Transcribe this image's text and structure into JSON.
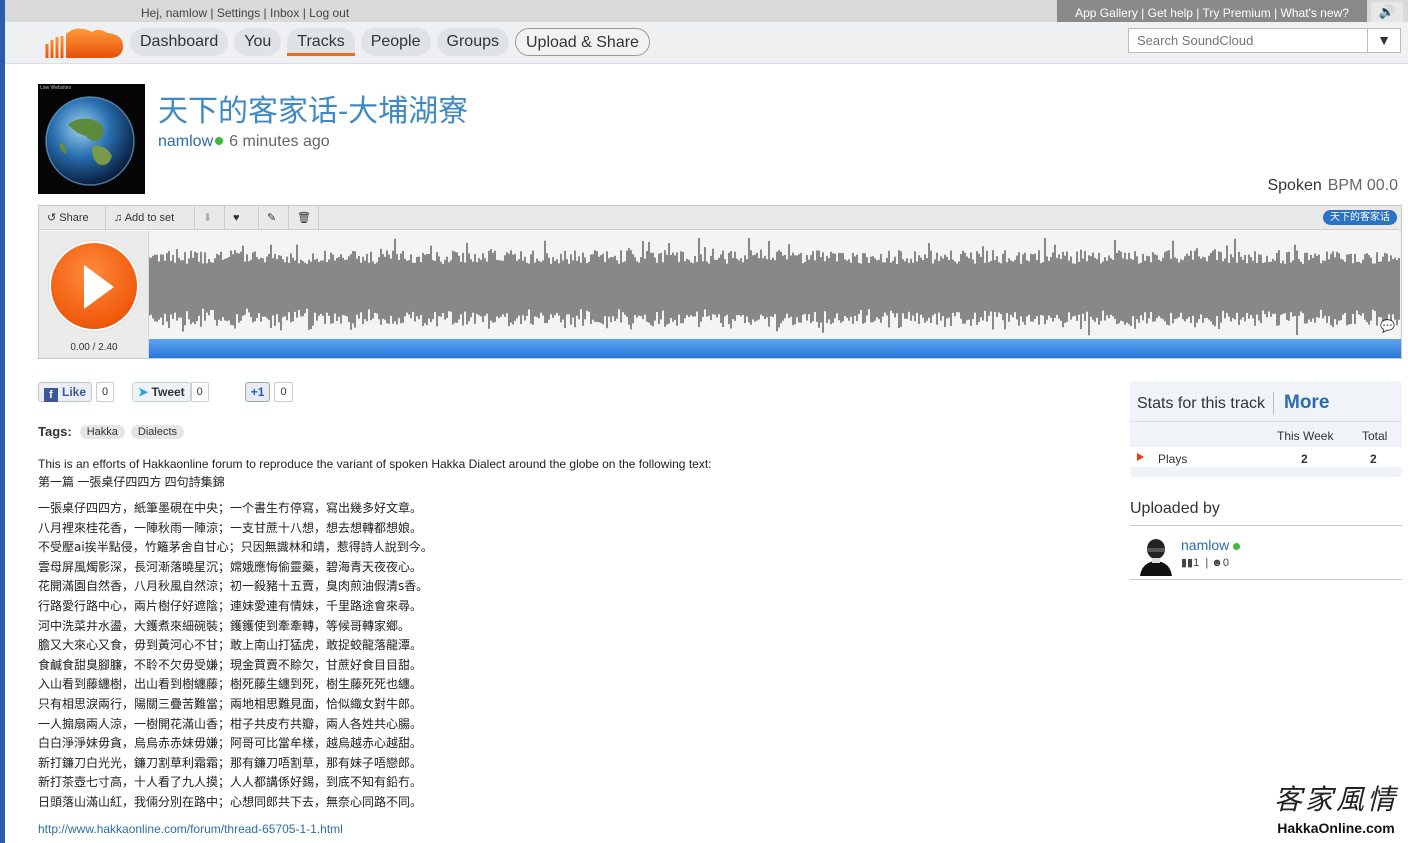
{
  "topbar": {
    "greeting": "Hej,",
    "username": "namlow",
    "links": [
      "Settings",
      "Inbox",
      "Log out"
    ],
    "app_links": "App Gallery | Get help | Try Premium | What's new?",
    "volume_icon": "speaker-icon"
  },
  "nav": {
    "items": [
      "Dashboard",
      "You",
      "Tracks",
      "People",
      "Groups"
    ],
    "active": "Tracks",
    "upload": "Upload & Share"
  },
  "search": {
    "placeholder": "Search SoundCloud",
    "value": "Search SoundCloud"
  },
  "track": {
    "artwork_text": "Low Websites",
    "title": "天下的客家话-大埔湖寮",
    "user": "namlow",
    "time": "6 minutes ago",
    "genre": "Spoken",
    "bpm": "BPM 00.0"
  },
  "player": {
    "toolbar": {
      "share": "Share",
      "add_to_set": "Add to set"
    },
    "tag": "天下的客家话",
    "timecode": "0.00 / 2.40",
    "colors": {
      "play": "#f05a0c",
      "progress": "#3a8ae6",
      "wave": "#888888"
    }
  },
  "social": {
    "like": "Like",
    "like_count": "0",
    "tweet": "Tweet",
    "tweet_count": "0",
    "plus": "+1",
    "plus_count": "0"
  },
  "tags": {
    "label": "Tags:",
    "items": [
      "Hakka",
      "Dialects"
    ]
  },
  "description": {
    "intro": "This is an efforts of Hakkaonline forum to reproduce the variant of spoken Hakka Dialect around the globe on the following text:",
    "heading": "第一篇 一張桌仔四四方 四句詩集錦",
    "poem": [
      "一張桌仔四四方，紙筆墨硯在中央；一个書生冇停寫，寫出幾多好文章。",
      "八月裡來桂花香，一陣秋雨一陣涼；一支甘蔗十八想，想去想轉都想娘。",
      "不受壓ai挨半點侵，竹籬茅舍自甘心；只因無識林和靖，惹得詩人說到今。",
      "雲母屏風燭影深，長河漸落曉星沉；嫦娥應悔偷靈藥，碧海青天夜夜心。",
      "花開滿園自然香，八月秋風自然涼；初一殺豬十五賣，臭肉煎油假清s香。",
      "行路愛行路中心，兩片樹仔好遮陰；連妹愛連有情妹，千里路途會來尋。",
      "河中洗菜井水盪，大鑊煮來細碗裝；鑊鑊使到牽牽轉，等候哥轉家鄉。",
      "膽又大來心又食，毋到黃河心不甘；敢上南山打猛虎，敢捉蛟龍落龍潭。",
      "食鹹食甜臭腳臁，不聆不欠毋受嫌；現金買賣不賒欠，甘蔗好食目目甜。",
      "入山看到藤纏樹，出山看到樹纏藤；樹死藤生纏到死，樹生藤死死也纏。",
      "只有相思淚兩行，陽關三疊苦難當；兩地相思難見面，恰似織女對牛郎。",
      "一人搧扇兩人涼，一樹開花滿山香；柑子共皮冇共瓣，兩人各姓共心腸。",
      "白白淨淨妹毋貪，烏烏赤赤妹毋嫌；阿哥可比當牟樣，越烏越赤心越甜。",
      "新打鐮刀白光光，鐮刀割草利霜霜；那有鐮刀唔割草，那有妹子唔戀郎。",
      "新打茶壺七寸高，十人看了九人摸；人人都講係好錫，到底不知有鉛冇。",
      "日頭落山滿山紅，我倆分別在路中；心想同郎共下去，無奈心同路不同。"
    ],
    "link": "http://www.hakkaonline.com/forum/thread-65705-1-1.html"
  },
  "stats": {
    "title": "Stats for this track",
    "more": "More",
    "col_week": "This Week",
    "col_total": "Total",
    "row_label": "Plays",
    "week": "2",
    "total": "2"
  },
  "uploaded_by": {
    "label": "Uploaded by",
    "user": "namlow",
    "tracks": "1",
    "followers": "0"
  },
  "watermark": {
    "cn": "客家風情",
    "en": "HakkaOnline.com"
  }
}
